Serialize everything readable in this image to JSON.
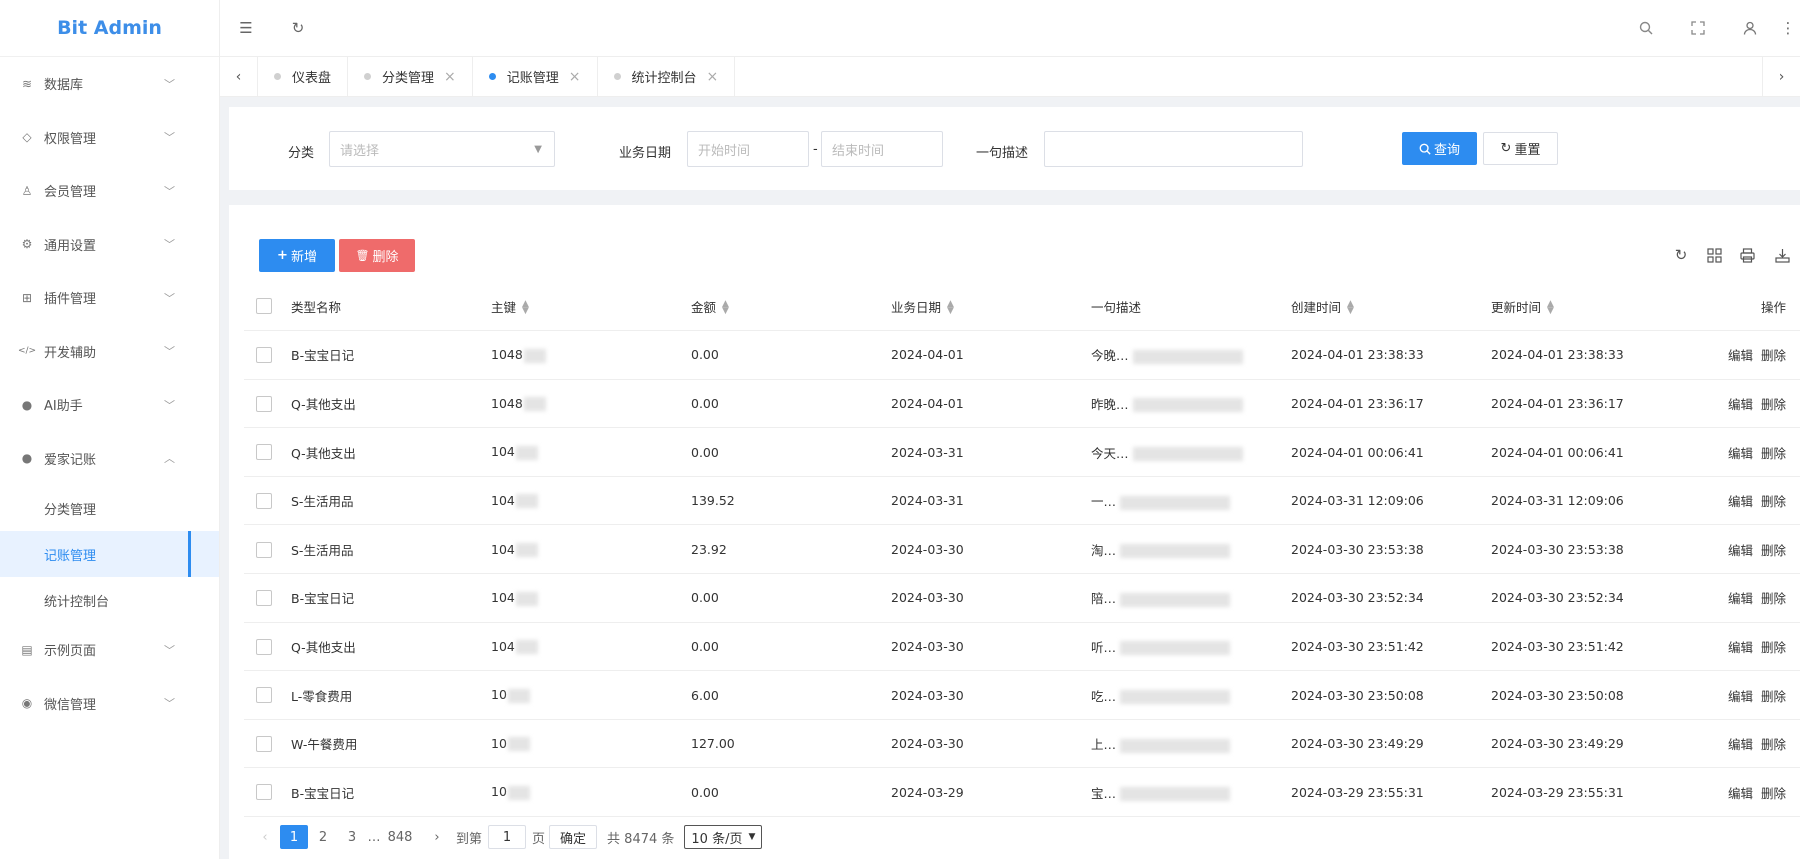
{
  "app": {
    "title": "Bit Admin"
  },
  "sidebar": {
    "items": [
      {
        "label": "数据库",
        "icon": "layers-icon",
        "expanded": false
      },
      {
        "label": "权限管理",
        "icon": "shield-icon",
        "expanded": false
      },
      {
        "label": "会员管理",
        "icon": "user-icon",
        "expanded": false
      },
      {
        "label": "通用设置",
        "icon": "gear-icon",
        "expanded": false
      },
      {
        "label": "插件管理",
        "icon": "plugin-icon",
        "expanded": false
      },
      {
        "label": "开发辅助",
        "icon": "code-icon",
        "expanded": false
      },
      {
        "label": "AI助手",
        "icon": "android-icon",
        "expanded": false
      },
      {
        "label": "爱家记账",
        "icon": "android-icon",
        "expanded": true
      },
      {
        "label": "示例页面",
        "icon": "page-icon",
        "expanded": false
      },
      {
        "label": "微信管理",
        "icon": "wechat-icon",
        "expanded": false
      }
    ],
    "subitems": [
      {
        "label": "分类管理",
        "active": false
      },
      {
        "label": "记账管理",
        "active": true
      },
      {
        "label": "统计控制台",
        "active": false
      }
    ]
  },
  "tabs": [
    {
      "label": "仪表盘",
      "active": false,
      "closable": false
    },
    {
      "label": "分类管理",
      "active": false,
      "closable": true
    },
    {
      "label": "记账管理",
      "active": true,
      "closable": true
    },
    {
      "label": "统计控制台",
      "active": false,
      "closable": true
    }
  ],
  "search": {
    "category_label": "分类",
    "category_placeholder": "请选择",
    "date_label": "业务日期",
    "start_placeholder": "开始时间",
    "date_sep": "-",
    "end_placeholder": "结束时间",
    "desc_label": "一句描述",
    "query_button": "查询",
    "reset_button": "重置"
  },
  "toolbar": {
    "add_label": "新增",
    "delete_label": "删除"
  },
  "table": {
    "columns": [
      "类型名称",
      "主键",
      "金额",
      "业务日期",
      "一句描述",
      "创建时间",
      "更新时间",
      "操作"
    ],
    "edit_label": "编辑",
    "delete_label": "删除",
    "rows": [
      {
        "type": "B-宝宝日记",
        "id": "1048",
        "amount": "0.00",
        "date": "2024-04-01",
        "desc": "今晚…",
        "created": "2024-04-01 23:38:33",
        "updated": "2024-04-01 23:38:33"
      },
      {
        "type": "Q-其他支出",
        "id": "1048",
        "amount": "0.00",
        "date": "2024-04-01",
        "desc": "昨晚…",
        "created": "2024-04-01 23:36:17",
        "updated": "2024-04-01 23:36:17"
      },
      {
        "type": "Q-其他支出",
        "id": "104",
        "amount": "0.00",
        "date": "2024-03-31",
        "desc": "今天…",
        "created": "2024-04-01 00:06:41",
        "updated": "2024-04-01 00:06:41"
      },
      {
        "type": "S-生活用品",
        "id": "104",
        "amount": "139.52",
        "date": "2024-03-31",
        "desc": "一…",
        "created": "2024-03-31 12:09:06",
        "updated": "2024-03-31 12:09:06"
      },
      {
        "type": "S-生活用品",
        "id": "104",
        "amount": "23.92",
        "date": "2024-03-30",
        "desc": "淘…",
        "created": "2024-03-30 23:53:38",
        "updated": "2024-03-30 23:53:38"
      },
      {
        "type": "B-宝宝日记",
        "id": "104",
        "amount": "0.00",
        "date": "2024-03-30",
        "desc": "陪…",
        "created": "2024-03-30 23:52:34",
        "updated": "2024-03-30 23:52:34"
      },
      {
        "type": "Q-其他支出",
        "id": "104",
        "amount": "0.00",
        "date": "2024-03-30",
        "desc": "听…",
        "created": "2024-03-30 23:51:42",
        "updated": "2024-03-30 23:51:42"
      },
      {
        "type": "L-零食费用",
        "id": "10",
        "amount": "6.00",
        "date": "2024-03-30",
        "desc": "吃…",
        "created": "2024-03-30 23:50:08",
        "updated": "2024-03-30 23:50:08"
      },
      {
        "type": "W-午餐费用",
        "id": "10",
        "amount": "127.00",
        "date": "2024-03-30",
        "desc": "上…",
        "created": "2024-03-30 23:49:29",
        "updated": "2024-03-30 23:49:29"
      },
      {
        "type": "B-宝宝日记",
        "id": "10",
        "amount": "0.00",
        "date": "2024-03-29",
        "desc": "宝…",
        "created": "2024-03-29 23:55:31",
        "updated": "2024-03-29 23:55:31"
      }
    ]
  },
  "pagination": {
    "pages": [
      "1",
      "2",
      "3"
    ],
    "ellipsis": "…",
    "last_page": "848",
    "goto_label": "到第",
    "goto_value": "1",
    "page_unit": "页",
    "confirm_label": "确定",
    "total_label": "共 8474 条",
    "page_size": "10 条/页"
  },
  "colors": {
    "primary": "#2d8cf0",
    "danger": "#ef6b6b",
    "brand": "#3d8ee8"
  }
}
